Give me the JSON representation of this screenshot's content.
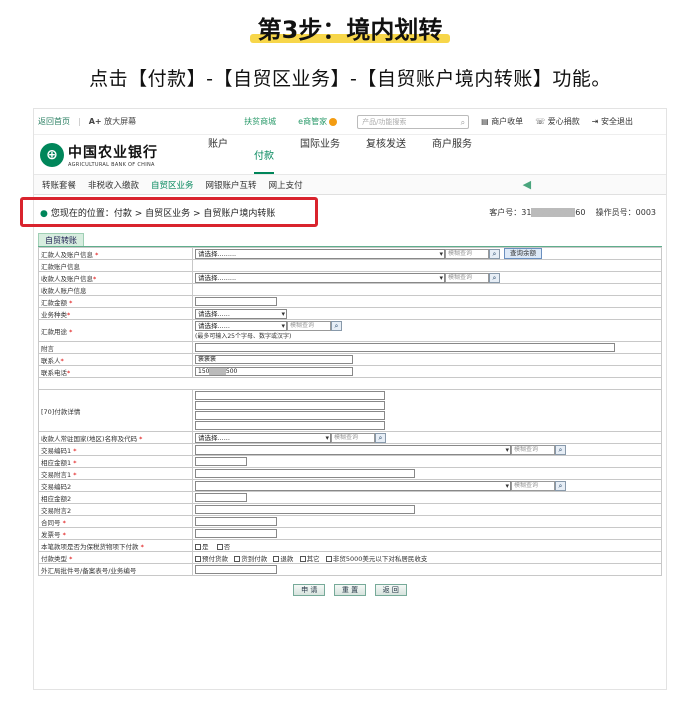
{
  "heading": {
    "title": "第3步：境内划转",
    "description": "点击【付款】-【自贸区业务】-【自贸账户境内转账】功能。"
  },
  "topbar": {
    "home": "返回首页",
    "zoom_plus": "A+",
    "zoom_label": "放大屏幕",
    "mall": "扶贫商城",
    "e_manager": "e商管家",
    "search_placeholder": "产品/功能搜索",
    "merchant": "商户收单",
    "donate": "爱心捐款",
    "logout": "安全退出"
  },
  "bank": {
    "name_cn": "中国农业银行",
    "name_en": "AGRICULTURAL BANK OF CHINA"
  },
  "main_nav": [
    "账户",
    "付款",
    "国际业务",
    "复核发送",
    "商户服务"
  ],
  "main_nav_active": "付款",
  "sub_nav": [
    "转账套餐",
    "非税收入缴款",
    "自贸区业务",
    "网银账户互转",
    "网上支付"
  ],
  "sub_nav_active": "自贸区业务",
  "location": {
    "text": "您现在的位置：付款 > 自贸区业务 > 自贸账户境内转账",
    "customer_label": "客户号：31",
    "customer_masked": "XXXXXXXX",
    "customer_tail": "60",
    "operator": "操作员号：0003"
  },
  "tab_label": "自贸转账",
  "form": {
    "payer_account": "汇款人及账户信息",
    "payer_info": "汇款账户信息",
    "payee_account": "收款人及账户信息",
    "payee_info": "收款人账户信息",
    "amount": "汇款金额",
    "biz_type": "业务种类",
    "purpose": "汇款用途",
    "purpose_note": "(最多可输入25个字母、数字或汉字)",
    "remark": "附言",
    "contact": "联系人",
    "contact_value": "褒褒褒",
    "phone": "联系电话",
    "phone_prefix": "150",
    "phone_masked": "XXXX",
    "phone_suffix": "500",
    "payment_detail": "[70]付款详情",
    "country": "收款人常驻国家(地区)名称及代码",
    "tx_code1": "交易编码1",
    "amount1": "相应金额1",
    "tx_remark1": "交易附言1",
    "tx_code2": "交易编码2",
    "amount2": "相应金额2",
    "tx_remark2": "交易附言2",
    "contract_no": "合同号",
    "invoice_no": "发票号",
    "bonded_q": "本笔款项是否为保税货物项下付款",
    "yes": "是",
    "no": "否",
    "pay_type": "付款类型",
    "pay_types": [
      "预付货款",
      "货到付款",
      "退款",
      "其它",
      "非贸5000美元以下对私居民收支"
    ],
    "forex_no": "外汇局批件号/备案表号/业务编号",
    "select_placeholder": "请选择.........",
    "select_short": "请选择......",
    "fuzzy": "模糊查询",
    "query_balance": "查询余额"
  },
  "buttons": {
    "apply": "申 请",
    "reset": "重 置",
    "back": "返 回"
  }
}
